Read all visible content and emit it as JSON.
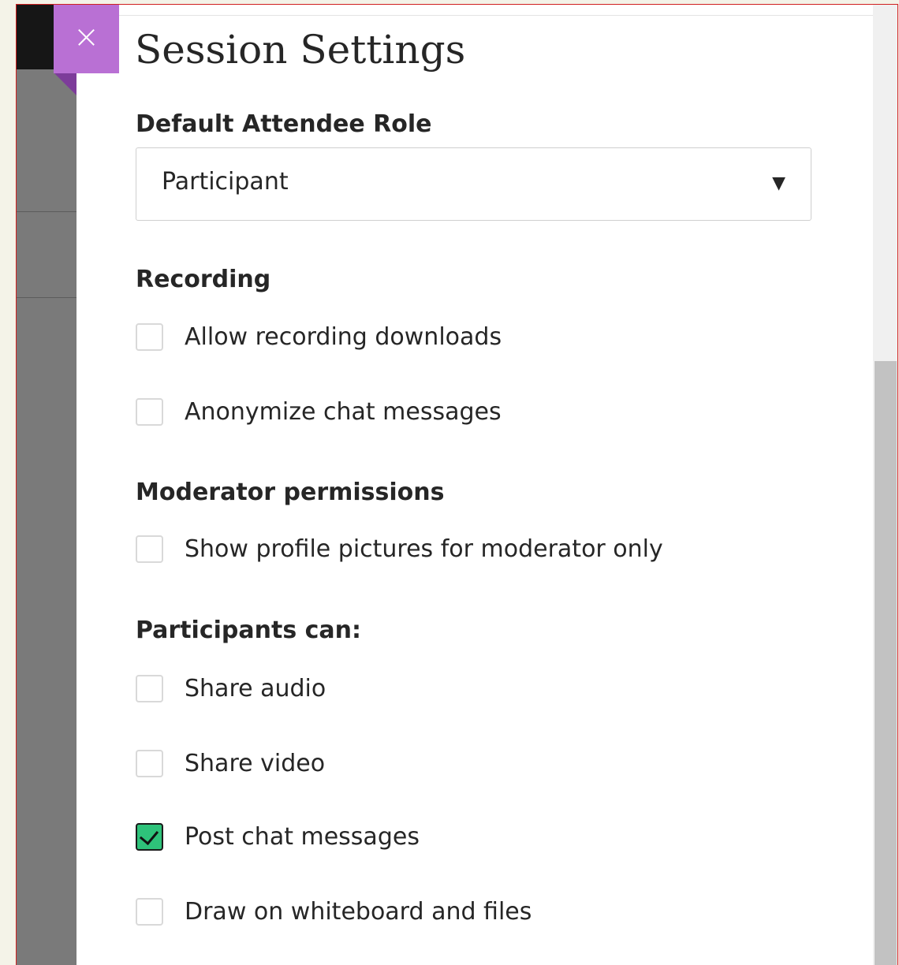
{
  "dialog": {
    "title": "Session Settings",
    "close_icon": "×"
  },
  "role": {
    "heading": "Default Attendee Role",
    "selected": "Participant",
    "caret_icon": "▼"
  },
  "recording": {
    "heading": "Recording",
    "options": [
      {
        "label": "Allow recording downloads",
        "checked": false
      },
      {
        "label": "Anonymize chat messages",
        "checked": false
      }
    ]
  },
  "moderator": {
    "heading": "Moderator permissions",
    "options": [
      {
        "label": "Show profile pictures for moderator only",
        "checked": false
      }
    ]
  },
  "participants": {
    "heading": "Participants can:",
    "options": [
      {
        "label": "Share audio",
        "checked": false
      },
      {
        "label": "Share video",
        "checked": false
      },
      {
        "label": "Post chat messages",
        "checked": true
      },
      {
        "label": "Draw on whiteboard and files",
        "checked": false
      }
    ]
  },
  "colors": {
    "accent_close": "#b970d4",
    "checkbox_checked": "#2ec27a"
  }
}
